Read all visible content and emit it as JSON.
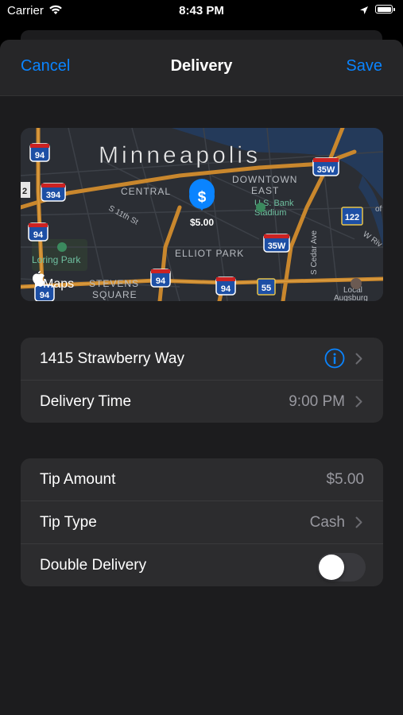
{
  "status_bar": {
    "carrier": "Carrier",
    "time": "8:43 PM"
  },
  "nav": {
    "cancel": "Cancel",
    "title": "Delivery",
    "save": "Save"
  },
  "map": {
    "city_label": "Minneapolis",
    "price_pin": "$5.00",
    "pin_symbol": "$",
    "maps_logo": "Maps",
    "labels": {
      "central": "CENTRAL",
      "downtown": "DOWNTOWN",
      "east": "EAST",
      "usbank": "U.S. Bank",
      "stadium": "Stadium",
      "s11th": "S 11th St",
      "loring": "Loring Park",
      "elliot": "ELLIOT PARK",
      "stevens": "STEVENS",
      "square": "SQUARE",
      "cedar": "S Cedar Ave",
      "wriv": "W Riv",
      "local": "Local",
      "augsburg": "Augsburg",
      "of": "of"
    },
    "shields": [
      "94",
      "394",
      "35W",
      "94",
      "35W",
      "94",
      "94",
      "55",
      "122",
      "2",
      "94"
    ]
  },
  "address_group": {
    "address": "1415 Strawberry Way",
    "delivery_time_label": "Delivery Time",
    "delivery_time_value": "9:00 PM"
  },
  "tip_group": {
    "tip_amount_label": "Tip Amount",
    "tip_amount_value": "$5.00",
    "tip_type_label": "Tip Type",
    "tip_type_value": "Cash",
    "double_delivery_label": "Double Delivery",
    "double_delivery_on": false
  },
  "colors": {
    "accent": "#0a84ff",
    "sheet": "#1c1c1e",
    "cell": "#2c2c2e",
    "secondary_text": "#98989f"
  }
}
